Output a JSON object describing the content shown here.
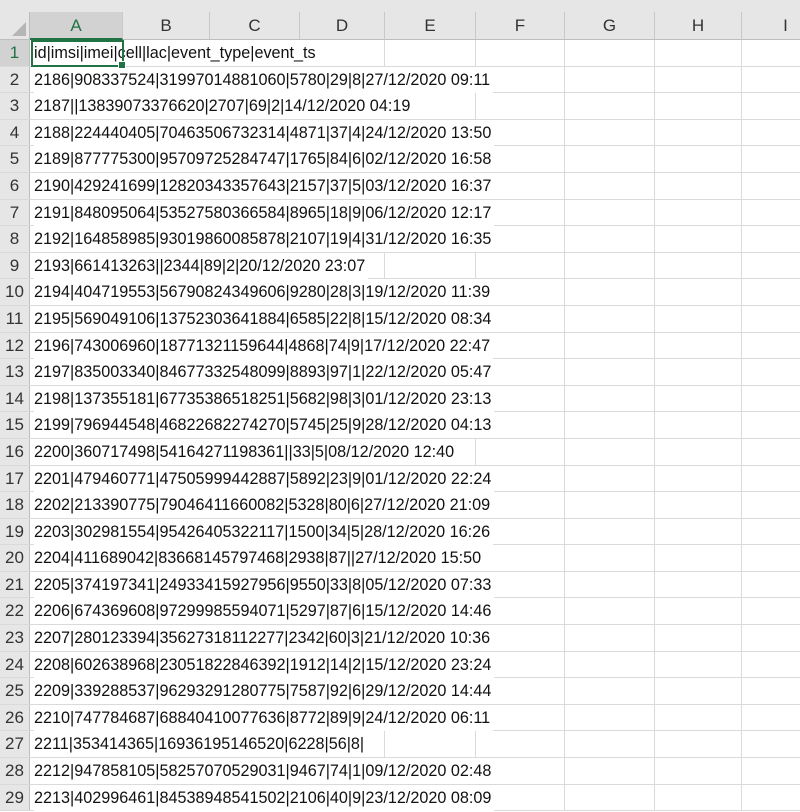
{
  "columns": [
    "A",
    "B",
    "C",
    "D",
    "E",
    "F",
    "G",
    "H",
    "I"
  ],
  "selected_cell": "A1",
  "rows": [
    {
      "n": "1",
      "text": "id|imsi|imei|cell|lac|event_type|event_ts"
    },
    {
      "n": "2",
      "text": "2186|908337524|31997014881060|5780|29|8|27/12/2020 09:11"
    },
    {
      "n": "3",
      "text": "2187||13839073376620|2707|69|2|14/12/2020 04:19"
    },
    {
      "n": "4",
      "text": "2188|224440405|70463506732314|4871|37|4|24/12/2020 13:50"
    },
    {
      "n": "5",
      "text": "2189|877775300|95709725284747|1765|84|6|02/12/2020 16:58"
    },
    {
      "n": "6",
      "text": "2190|429241699|12820343357643|2157|37|5|03/12/2020 16:37"
    },
    {
      "n": "7",
      "text": "2191|848095064|53527580366584|8965|18|9|06/12/2020 12:17"
    },
    {
      "n": "8",
      "text": "2192|164858985|93019860085878|2107|19|4|31/12/2020 16:35"
    },
    {
      "n": "9",
      "text": "2193|661413263||2344|89|2|20/12/2020 23:07"
    },
    {
      "n": "10",
      "text": "2194|404719553|56790824349606|9280|28|3|19/12/2020 11:39"
    },
    {
      "n": "11",
      "text": "2195|569049106|13752303641884|6585|22|8|15/12/2020 08:34"
    },
    {
      "n": "12",
      "text": "2196|743006960|18771321159644|4868|74|9|17/12/2020 22:47"
    },
    {
      "n": "13",
      "text": "2197|835003340|84677332548099|8893|97|1|22/12/2020 05:47"
    },
    {
      "n": "14",
      "text": "2198|137355181|67735386518251|5682|98|3|01/12/2020 23:13"
    },
    {
      "n": "15",
      "text": "2199|796944548|46822682274270|5745|25|9|28/12/2020 04:13"
    },
    {
      "n": "16",
      "text": "2200|360717498|54164271198361||33|5|08/12/2020 12:40"
    },
    {
      "n": "17",
      "text": "2201|479460771|47505999442887|5892|23|9|01/12/2020 22:24"
    },
    {
      "n": "18",
      "text": "2202|213390775|79046411660082|5328|80|6|27/12/2020 21:09"
    },
    {
      "n": "19",
      "text": "2203|302981554|95426405322117|1500|34|5|28/12/2020 16:26"
    },
    {
      "n": "20",
      "text": "2204|411689042|83668145797468|2938|87||27/12/2020 15:50"
    },
    {
      "n": "21",
      "text": "2205|374197341|24933415927956|9550|33|8|05/12/2020 07:33"
    },
    {
      "n": "22",
      "text": "2206|674369608|97299985594071|5297|87|6|15/12/2020 14:46"
    },
    {
      "n": "23",
      "text": "2207|280123394|35627318112277|2342|60|3|21/12/2020 10:36"
    },
    {
      "n": "24",
      "text": "2208|602638968|23051822846392|1912|14|2|15/12/2020 23:24"
    },
    {
      "n": "25",
      "text": "2209|339288537|96293291280775|7587|92|6|29/12/2020 14:44"
    },
    {
      "n": "26",
      "text": "2210|747784687|68840410077636|8772|89|9|24/12/2020 06:11"
    },
    {
      "n": "27",
      "text": "2211|353414365|16936195146520|6228|56|8|"
    },
    {
      "n": "28",
      "text": "2212|947858105|58257070529031|9467|74|1|09/12/2020 02:48"
    },
    {
      "n": "29",
      "text": "2213|402996461|84538948541502|2106|40|9|23/12/2020 08:09"
    }
  ]
}
